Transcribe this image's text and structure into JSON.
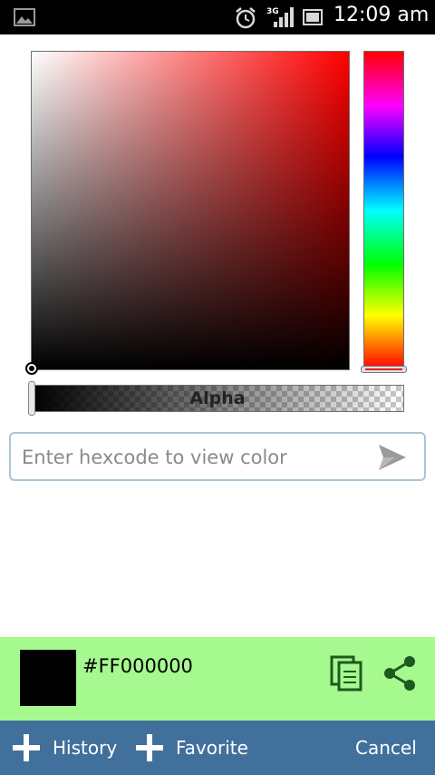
{
  "status_bar": {
    "time": "12:09 am",
    "network": "3G",
    "icons": [
      "gallery-icon",
      "alarm-icon",
      "signal-icon",
      "battery-icon"
    ]
  },
  "picker": {
    "alpha_label": "Alpha",
    "hue_color": "#ff0000",
    "alpha_level": 0
  },
  "hex_entry": {
    "placeholder": "Enter hexcode to view color",
    "value": ""
  },
  "result": {
    "hex": "#FF000000",
    "swatch_color": "#000000",
    "panel_color": "#a6f98e"
  },
  "bottom_bar": {
    "history_label": "History",
    "favorite_label": "Favorite",
    "cancel_label": "Cancel",
    "bar_color": "#41709c"
  }
}
